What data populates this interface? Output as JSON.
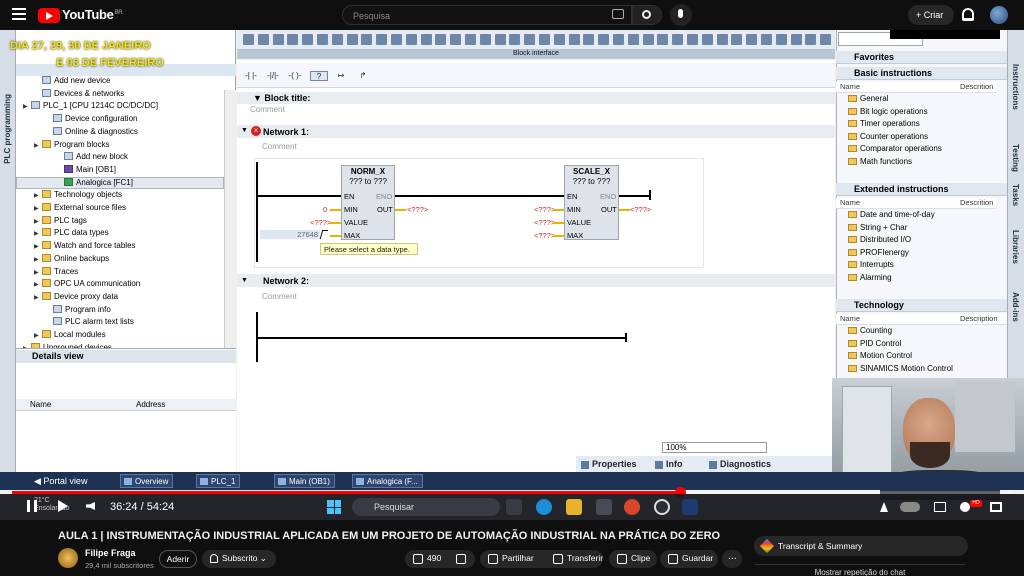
{
  "youtube": {
    "logo_text": "YouTube",
    "region": "BR",
    "search_placeholder": "Pesquisa",
    "create_label": "Criar"
  },
  "overlay": {
    "line1": "DIA 27, 29, 30 DE JANEIRO",
    "line2": "E 03 DE FEVEREIRO"
  },
  "tia": {
    "left_vtab": "PLC programming",
    "project_tree": [
      {
        "label": "Add new device",
        "indent": 2,
        "icon": "add-device"
      },
      {
        "label": "Devices & networks",
        "indent": 2,
        "icon": "network"
      },
      {
        "label": "PLC_1 [CPU 1214C DC/DC/DC]",
        "indent": 1,
        "icon": "cpu"
      },
      {
        "label": "Device configuration",
        "indent": 3,
        "icon": "config"
      },
      {
        "label": "Online & diagnostics",
        "indent": 3,
        "icon": "diag"
      },
      {
        "label": "Program blocks",
        "indent": 2,
        "icon": "folder"
      },
      {
        "label": "Add new block",
        "indent": 4,
        "icon": "add-block"
      },
      {
        "label": "Main [OB1]",
        "indent": 4,
        "icon": "ob"
      },
      {
        "label": "Analogica [FC1]",
        "indent": 4,
        "icon": "fc"
      },
      {
        "label": "Technology objects",
        "indent": 2,
        "icon": "folder"
      },
      {
        "label": "External source files",
        "indent": 2,
        "icon": "folder"
      },
      {
        "label": "PLC tags",
        "indent": 2,
        "icon": "folder"
      },
      {
        "label": "PLC data types",
        "indent": 2,
        "icon": "folder"
      },
      {
        "label": "Watch and force tables",
        "indent": 2,
        "icon": "folder"
      },
      {
        "label": "Online backups",
        "indent": 2,
        "icon": "folder"
      },
      {
        "label": "Traces",
        "indent": 2,
        "icon": "folder"
      },
      {
        "label": "OPC UA communication",
        "indent": 2,
        "icon": "folder"
      },
      {
        "label": "Device proxy data",
        "indent": 2,
        "icon": "folder"
      },
      {
        "label": "Program info",
        "indent": 3,
        "icon": "doc"
      },
      {
        "label": "PLC alarm text lists",
        "indent": 3,
        "icon": "doc"
      },
      {
        "label": "Local modules",
        "indent": 2,
        "icon": "folder"
      },
      {
        "label": "Ungrouped devices",
        "indent": 1,
        "icon": "folder"
      }
    ],
    "details_view": "Details view",
    "details_cols": [
      "Name",
      "Address"
    ],
    "block_interface": "Block interface",
    "block_title_label": "Block title:",
    "comment_label": "Comment",
    "network1_label": "Network 1:",
    "network2_label": "Network 2:",
    "norm": {
      "name": "NORM_X",
      "types": "??? to ???",
      "en": "EN",
      "eno": "ENO",
      "min": "MIN",
      "out": "OUT",
      "value": "VALUE",
      "max": "MAX",
      "min_val": "0",
      "value_val": "<???>",
      "max_val": "27648",
      "out_val": "<???>"
    },
    "scale": {
      "name": "SCALE_X",
      "types": "??? to ???",
      "en": "EN",
      "eno": "ENO",
      "min": "MIN",
      "out": "OUT",
      "value": "VALUE",
      "max": "MAX",
      "min_val": "<???>",
      "value_val": "<???>",
      "max_val": "<???>",
      "out_val": "<???>"
    },
    "tooltip": "Please select a data type.",
    "zoom": "100%",
    "prop_tabs": [
      "Properties",
      "Info",
      "Diagnostics"
    ],
    "instructions_sections": {
      "favorites": "Favorites",
      "basic": "Basic instructions",
      "extended": "Extended instructions",
      "technology": "Technology",
      "col_name": "Name",
      "col_desc": "Descrition",
      "col_desc_tech": "Description"
    },
    "basic_items": [
      "General",
      "Bit logic operations",
      "Timer operations",
      "Counter operations",
      "Comparator operations",
      "Math functions"
    ],
    "extended_items": [
      "Date and time-of-day",
      "String + Char",
      "Distributed I/O",
      "PROFIenergy",
      "Interrupts",
      "Alarming"
    ],
    "technology_items": [
      "Counting",
      "PID Control",
      "Motion Control",
      "SINAMICS Motion Control"
    ],
    "right_vtabs": [
      "Instructions",
      "Testing",
      "Tasks",
      "Libraries",
      "Add-ins"
    ],
    "portal_view": "Portal view",
    "taskbar_items": [
      "Overview",
      "PLC_1",
      "Main (OB1)",
      "Analogica (F..."
    ]
  },
  "player": {
    "time": "36:24 / 54:24",
    "progress": 0.668,
    "weather_temp": "21°C",
    "weather_desc": "Ensolarado",
    "win_search": "Pesquisar",
    "hd_badge": "HD"
  },
  "video": {
    "title": "AULA 1 | INSTRUMENTAÇÃO INDUSTRIAL APLICADA EM UM PROJETO DE AUTOMAÇÃO INDUSTRIAL NA PRÁTICA DO ZERO",
    "channel": "Filipe Fraga",
    "subs": "29,4 mil subscritores",
    "join": "Aderir",
    "subscribe": "Subscrito",
    "likes": "490",
    "share": "Partilhar",
    "download": "Transferir",
    "clip": "Clipe",
    "save": "Guardar",
    "transcript": "Transcript & Summary",
    "replay": "Mostrar repetição do chat"
  }
}
